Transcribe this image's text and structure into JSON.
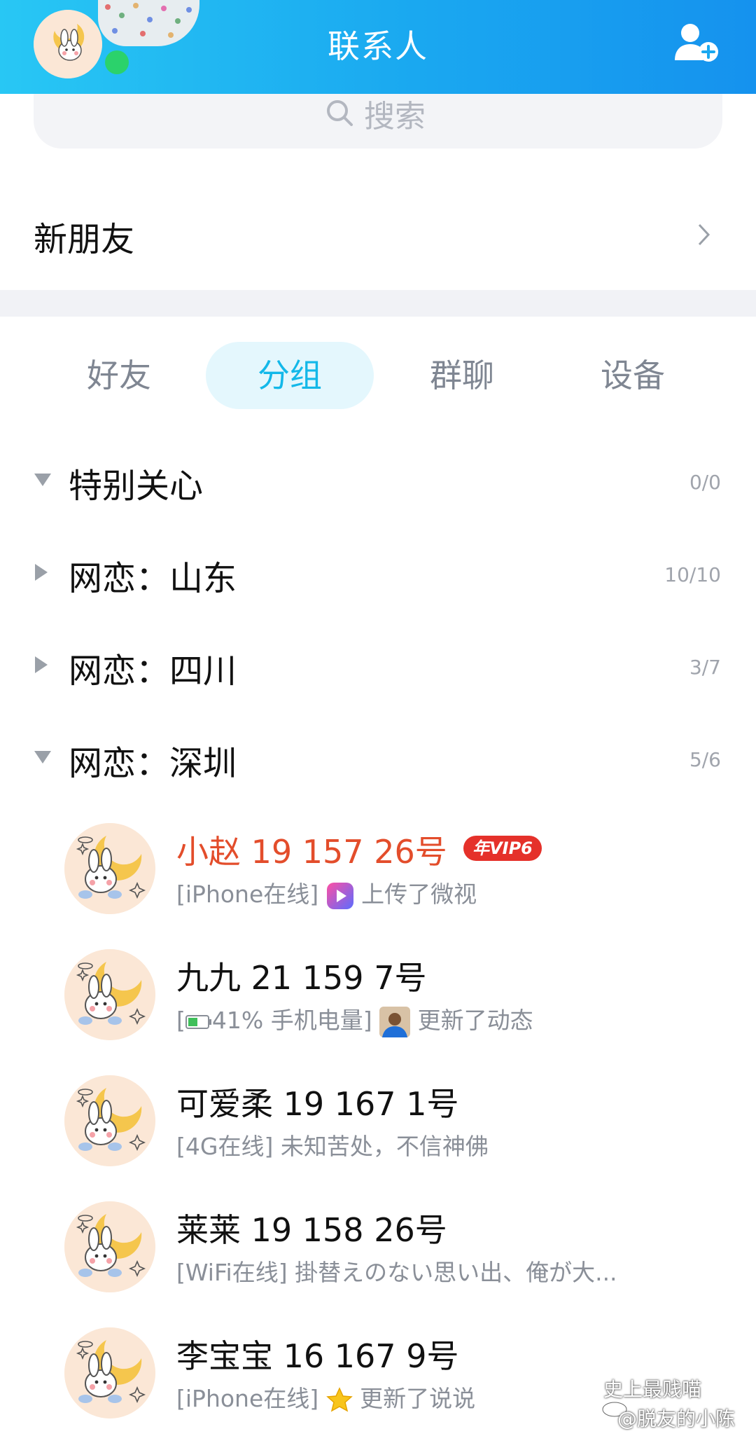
{
  "header": {
    "title": "联系人"
  },
  "search": {
    "placeholder": "搜索"
  },
  "new_friends": {
    "label": "新朋友"
  },
  "tabs": [
    {
      "label": "好友",
      "active": false
    },
    {
      "label": "分组",
      "active": true
    },
    {
      "label": "群聊",
      "active": false
    },
    {
      "label": "设备",
      "active": false
    }
  ],
  "groups": [
    {
      "name": "特别关心",
      "count": "0/0",
      "expanded": true
    },
    {
      "name": "网恋：山东",
      "count": "10/10",
      "expanded": false
    },
    {
      "name": "网恋：四川",
      "count": "3/7",
      "expanded": false
    },
    {
      "name": "网恋：深圳",
      "count": "5/6",
      "expanded": true
    }
  ],
  "contacts": [
    {
      "name": "小赵 19 157 26号",
      "status_prefix": "[iPhone在线]",
      "status_text": "上传了微视",
      "badge": "年VIP6",
      "status_icon": "weishi-icon"
    },
    {
      "name": "九九 21 159 7号",
      "status_prefix": "[",
      "battery": "41% 手机电量]",
      "status_text": "更新了动态",
      "status_icon": "avatar-thumb-icon"
    },
    {
      "name": "可爱柔 19 167 1号",
      "status_prefix": "[4G在线]",
      "status_text": "未知苦处，不信神佛"
    },
    {
      "name": "莱莱 19 158 26号",
      "status_prefix": "[WiFi在线]",
      "status_text": "掛替えのない思い出、俺が大..."
    },
    {
      "name": "李宝宝 16 167 9号",
      "status_prefix": "[iPhone在线]",
      "status_text": "更新了说说",
      "status_icon": "star-icon"
    }
  ],
  "watermark": {
    "line1": "史上最贱喵",
    "line2": "@脱友的小陈"
  },
  "colors": {
    "header_start": "#28c7f4",
    "header_end": "#1592ee",
    "accent": "#13b8e9",
    "vip_name": "#e34d2b",
    "vip_badge": "#e5312a"
  }
}
